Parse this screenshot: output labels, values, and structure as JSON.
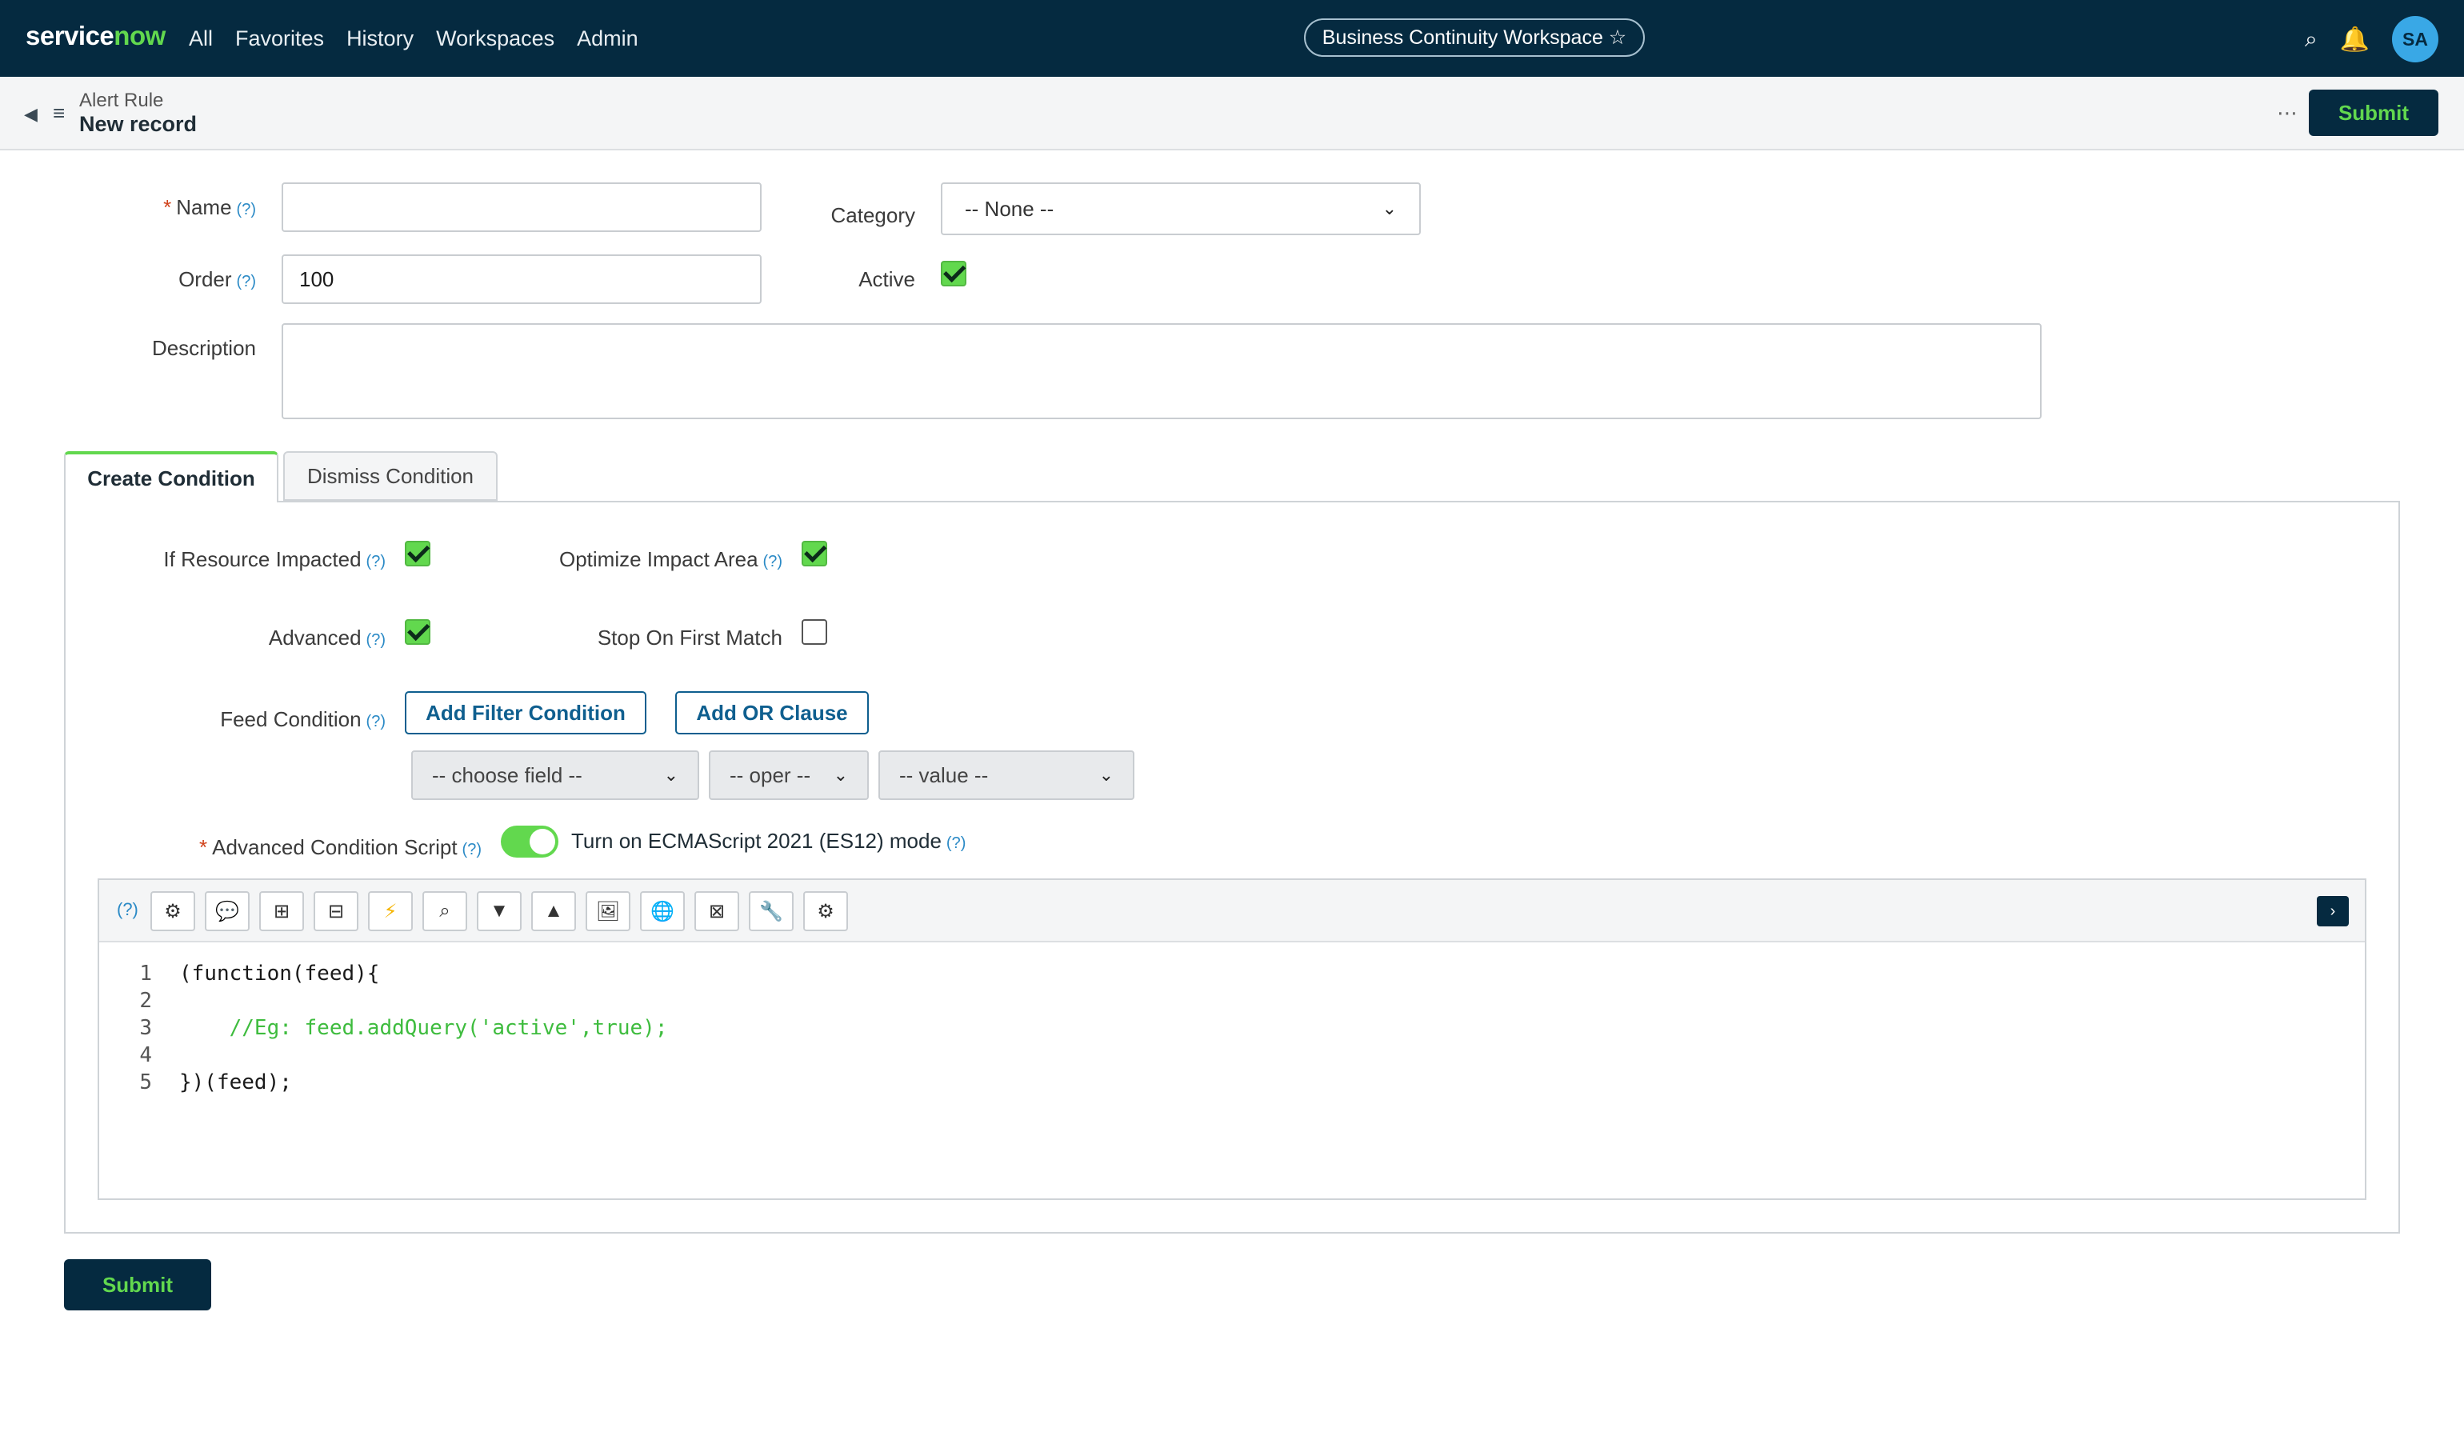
{
  "nav": {
    "brand_part1": "service",
    "brand_part2": "now",
    "links": [
      "All",
      "Favorites",
      "History",
      "Workspaces",
      "Admin"
    ],
    "workspace": "Business Continuity Workspace ☆",
    "avatar": "SA"
  },
  "header": {
    "record_type": "Alert Rule",
    "record_name": "New record",
    "more": "⋯",
    "submit_label": "Submit"
  },
  "form": {
    "name_label": "Name",
    "name_value": "",
    "help": "(?)",
    "required": "*",
    "order_label": "Order",
    "order_value": "100",
    "category_label": "Category",
    "category_value": "-- None --",
    "active_label": "Active",
    "active_checked": true,
    "description_label": "Description",
    "description_value": ""
  },
  "tabs": {
    "create": "Create Condition",
    "dismiss": "Dismiss Condition"
  },
  "condition": {
    "if_resource_label": "If Resource Impacted",
    "optimize_label": "Optimize Impact Area",
    "advanced_label": "Advanced",
    "stop_label": "Stop On First Match",
    "feed_label": "Feed Condition",
    "add_filter": "Add Filter Condition",
    "add_or": "Add OR Clause",
    "choose_field": "-- choose field --",
    "oper": "-- oper --",
    "value": "-- value --",
    "script_label": "Advanced Condition Script",
    "es_mode": "Turn on ECMAScript 2021 (ES12) mode"
  },
  "editor": {
    "help": "(?)",
    "toolbar_icons": [
      "gear-icon",
      "comment-icon",
      "format-icon",
      "collapse-icon",
      "script-debug-icon",
      "search-icon",
      "arrow-down-icon",
      "arrow-up-icon",
      "image-icon",
      "globe-icon",
      "fullscreen-icon",
      "wrench-icon",
      "settings-icon"
    ],
    "lines": [
      {
        "n": "1",
        "text": "(function(feed){",
        "comment": false
      },
      {
        "n": "2",
        "text": "",
        "comment": false
      },
      {
        "n": "3",
        "text": "    //Eg: feed.addQuery('active',true);",
        "comment": true
      },
      {
        "n": "4",
        "text": "",
        "comment": false
      },
      {
        "n": "5",
        "text": "})(feed);",
        "comment": false
      }
    ]
  },
  "footer": {
    "submit_label": "Submit"
  }
}
